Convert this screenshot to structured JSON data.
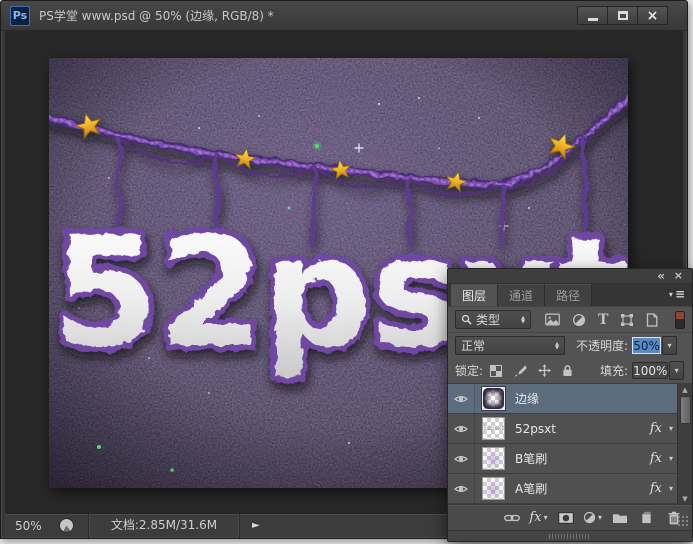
{
  "window": {
    "logo": "Ps",
    "title": "PS学堂 www.psd @ 50% (边缘, RGB/8) *"
  },
  "icons": {
    "close": "×",
    "collapse": "«",
    "menu": "≡",
    "caret_down": "▾",
    "arrow_right": "►",
    "arrow_up": "▲",
    "arrow_down": "▼",
    "type_letter": "T",
    "fx": "fx"
  },
  "artwork": {
    "text": "52psxt"
  },
  "statusbar": {
    "zoom": "50%",
    "doc_info": "文档:2.85M/31.6M"
  },
  "layers_panel": {
    "tabs": [
      {
        "label": "图层"
      },
      {
        "label": "通道"
      },
      {
        "label": "路径"
      }
    ],
    "filter": {
      "kind_label": "类型"
    },
    "blend": {
      "mode": "正常",
      "opacity_label": "不透明度:",
      "opacity_value": "50%"
    },
    "lock": {
      "lock_label": "锁定:",
      "fill_label": "填充:",
      "fill_value": "100%"
    },
    "layers": [
      {
        "name": "边缘"
      },
      {
        "name": "52psxt"
      },
      {
        "name": "B笔刷"
      },
      {
        "name": "A笔刷"
      }
    ]
  },
  "colors": {
    "selected_layer_row": "#5d6c7c",
    "opacity_selection": "#5a8ac4",
    "canvas_purple": "#2d2240",
    "star_gold": "#f0b429"
  }
}
